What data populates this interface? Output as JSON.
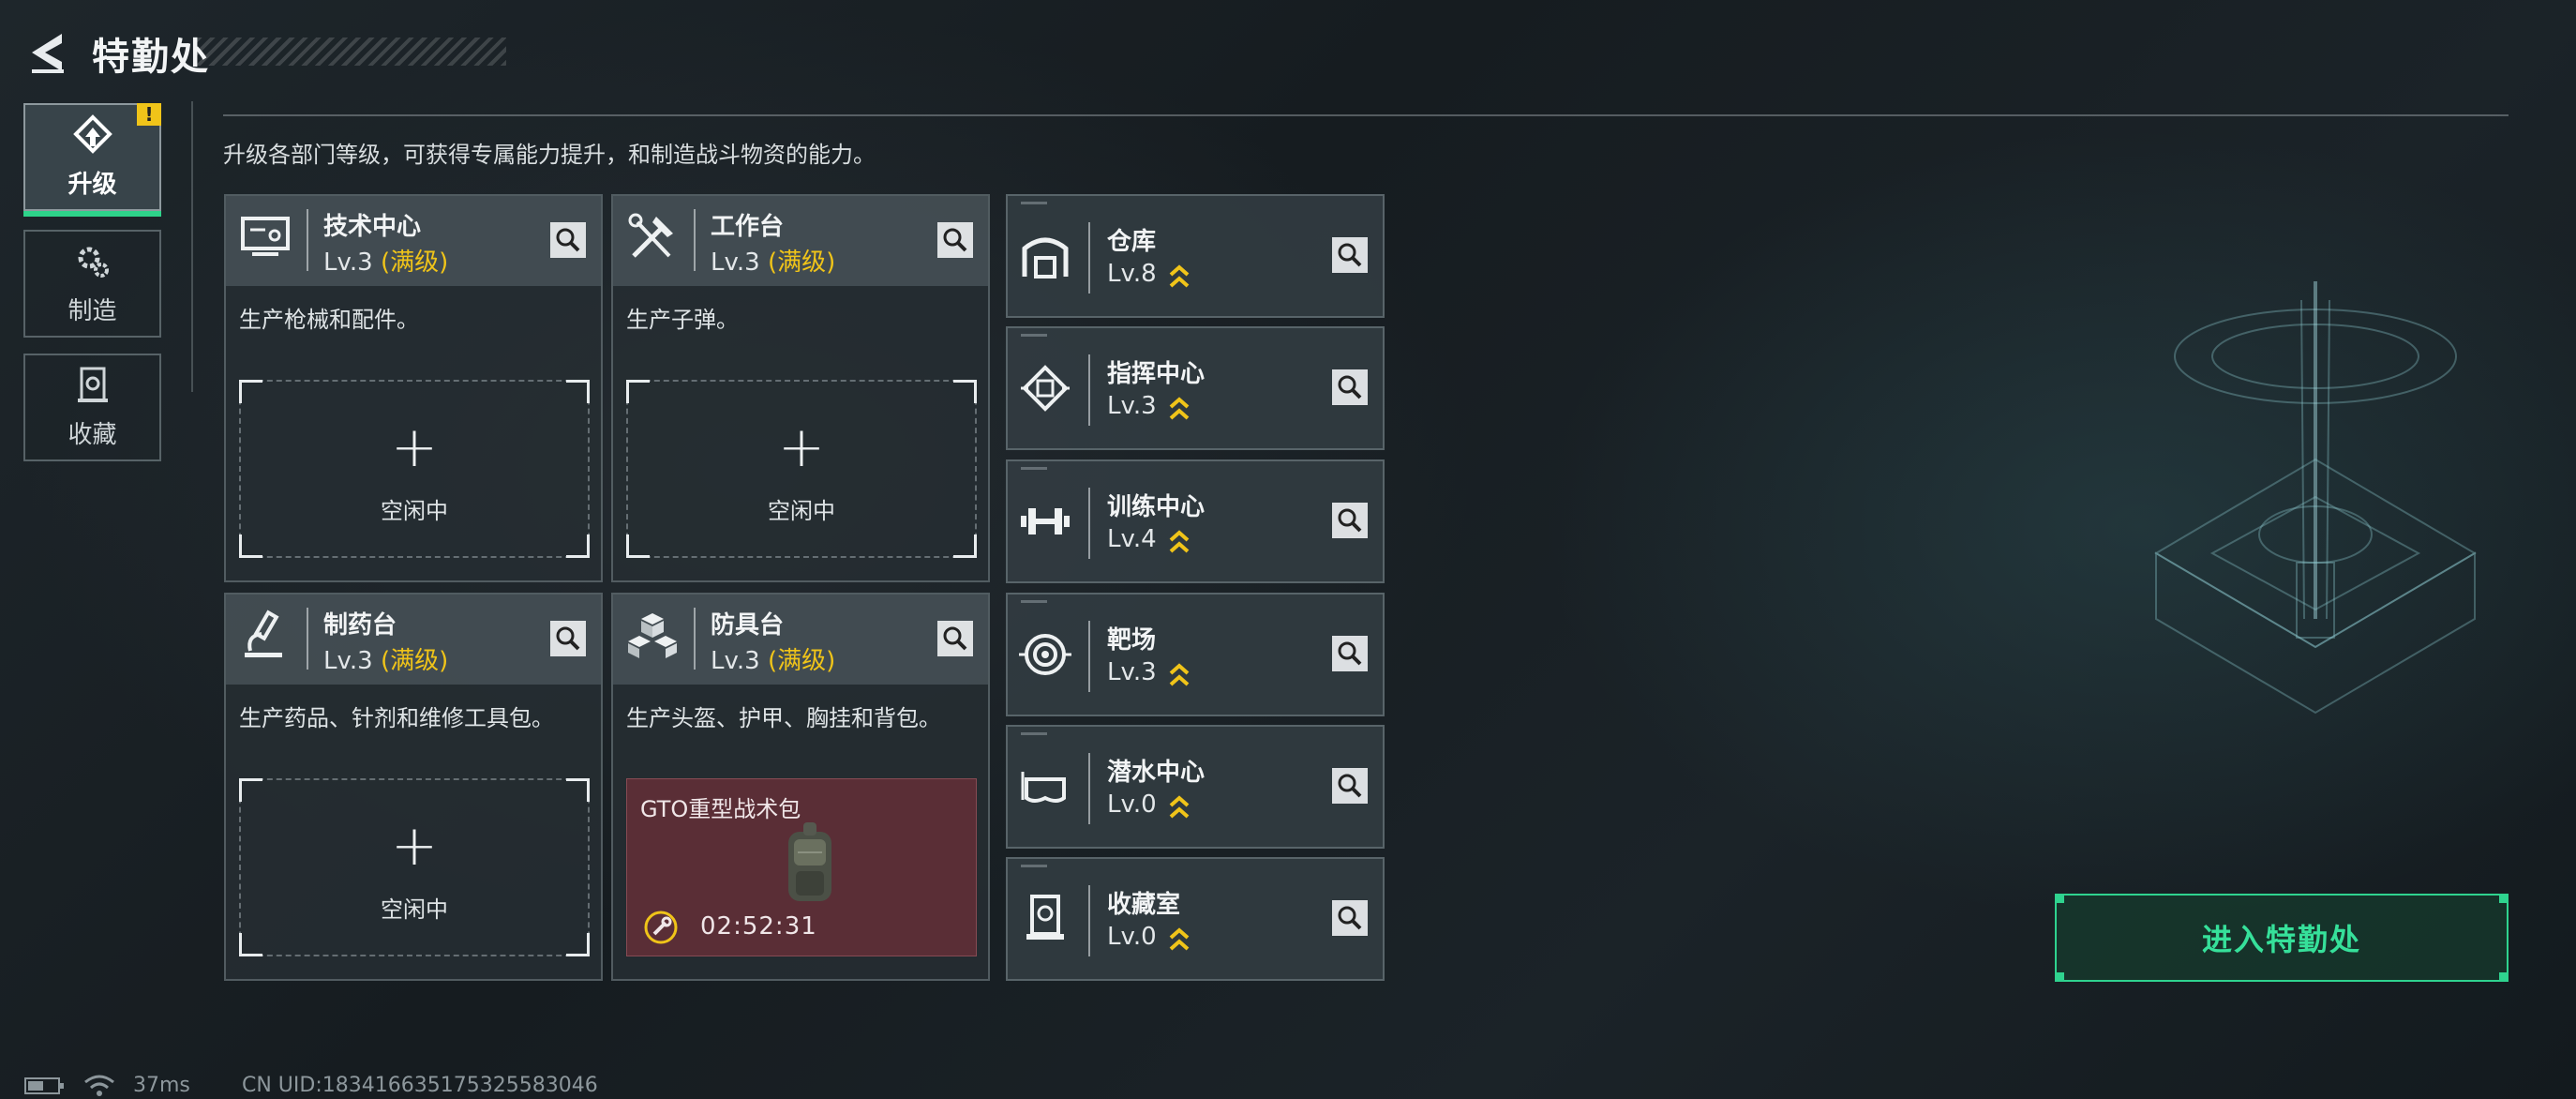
{
  "header": {
    "title": "特勤处"
  },
  "subtitle": "升级各部门等级，可获得专属能力提升，和制造战斗物资的能力。",
  "tabs": [
    {
      "label": "升级",
      "active": true,
      "badge": "!"
    },
    {
      "label": "制造",
      "active": false
    },
    {
      "label": "收藏",
      "active": false
    }
  ],
  "cards": [
    {
      "name": "技术中心",
      "level": "Lv.3",
      "status": "(满级)",
      "desc": "生产枪械和配件。",
      "slot": {
        "plus": "+",
        "idle": "空闲中"
      },
      "icon": "computer-icon"
    },
    {
      "name": "工作台",
      "level": "Lv.3",
      "status": "(满级)",
      "desc": "生产子弹。",
      "slot": {
        "plus": "+",
        "idle": "空闲中"
      },
      "icon": "tools-icon"
    },
    {
      "name": "制药台",
      "level": "Lv.3",
      "status": "(满级)",
      "desc": "生产药品、针剂和维修工具包。",
      "slot": {
        "plus": "+",
        "idle": "空闲中"
      },
      "icon": "microscope-icon"
    },
    {
      "name": "防具台",
      "level": "Lv.3",
      "status": "(满级)",
      "desc": "生产头盔、护甲、胸挂和背包。",
      "craft": {
        "name": "GTO重型战术包",
        "time": "02:52:31"
      },
      "icon": "armor-blocks-icon"
    }
  ],
  "small_cards": [
    {
      "name": "仓库",
      "level": "Lv.8",
      "icon": "warehouse-icon"
    },
    {
      "name": "指挥中心",
      "level": "Lv.3",
      "icon": "command-chip-icon"
    },
    {
      "name": "训练中心",
      "level": "Lv.4",
      "icon": "dumbbell-icon"
    },
    {
      "name": "靶场",
      "level": "Lv.3",
      "icon": "target-icon"
    },
    {
      "name": "潜水中心",
      "level": "Lv.0",
      "icon": "diving-mask-icon"
    },
    {
      "name": "收藏室",
      "level": "Lv.0",
      "icon": "collection-icon"
    }
  ],
  "enter_button": "进入特勤处",
  "status": {
    "ping": "37ms",
    "uid": "CN UID:183416635175325583046"
  },
  "colors": {
    "accent_green": "#2fd38f",
    "max_level_yellow": "#f0c419",
    "craft_bg": "#5a2e36"
  }
}
